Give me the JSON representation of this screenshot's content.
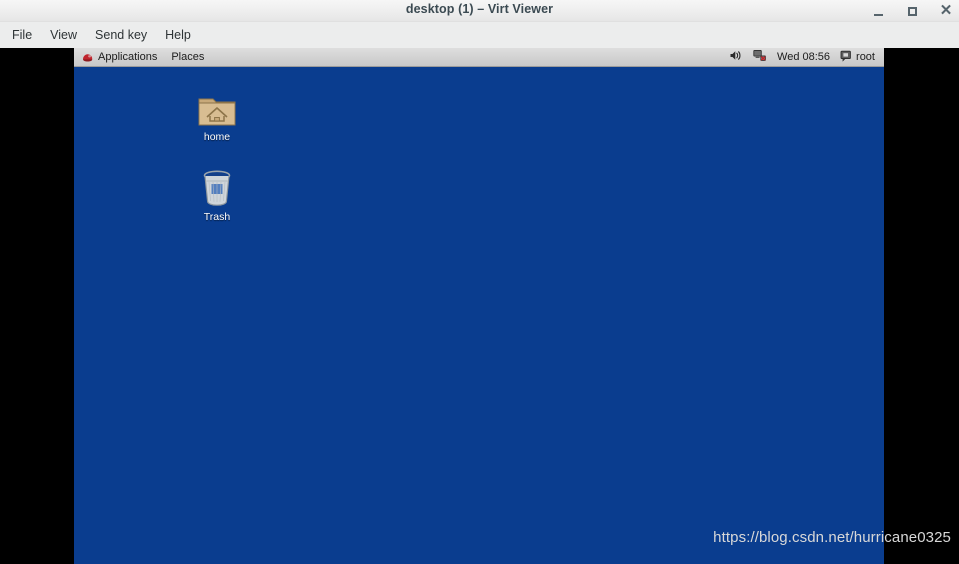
{
  "window": {
    "title": "desktop (1) – Virt Viewer",
    "controls": {
      "minimize": "–",
      "maximize": "□",
      "close": "✕"
    }
  },
  "menubar": {
    "items": [
      {
        "label": "File"
      },
      {
        "label": "View"
      },
      {
        "label": "Send key"
      },
      {
        "label": "Help"
      }
    ]
  },
  "guest_panel": {
    "applications_label": "Applications",
    "places_label": "Places",
    "clock": "Wed 08:56",
    "user": "root",
    "icons": {
      "logo": "redhat-logo-icon",
      "volume": "speaker-icon",
      "network": "network-disconnected-icon",
      "user_status": "chat-bubble-icon"
    }
  },
  "desktop": {
    "background_color": "#0a3d8f",
    "icons": [
      {
        "name": "home-folder-icon",
        "label": "home"
      },
      {
        "name": "trash-icon",
        "label": "Trash"
      }
    ]
  },
  "watermark": {
    "text": "https://blog.csdn.net/hurricane0325"
  }
}
